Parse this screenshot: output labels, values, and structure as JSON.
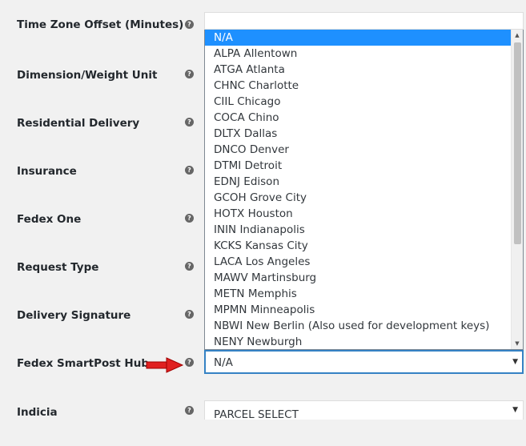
{
  "form": {
    "rows": [
      {
        "label": "Time Zone Offset (Minutes)"
      },
      {
        "label": "Dimension/Weight Unit"
      },
      {
        "label": "Residential Delivery"
      },
      {
        "label": "Insurance"
      },
      {
        "label": "Fedex One"
      },
      {
        "label": "Request Type"
      },
      {
        "label": "Delivery Signature"
      },
      {
        "label": "Fedex SmartPost Hub"
      },
      {
        "label": "Indicia"
      }
    ],
    "help_icon": "question-mark-icon",
    "smartpost_hub": {
      "value": "N/A",
      "options": [
        "N/A",
        "ALPA Allentown",
        "ATGA Atlanta",
        "CHNC Charlotte",
        "CIIL Chicago",
        "COCA Chino",
        "DLTX Dallas",
        "DNCO Denver",
        "DTMI Detroit",
        "EDNJ Edison",
        "GCOH Grove City",
        "HOTX Houston",
        "ININ Indianapolis",
        "KCKS Kansas City",
        "LACA Los Angeles",
        "MAWV Martinsburg",
        "METN Memphis",
        "MPMN Minneapolis",
        "NBWI New Berlin (Also used for development keys)",
        "NENY Newburgh"
      ]
    },
    "indicia": {
      "value": "PARCEL SELECT"
    }
  },
  "colors": {
    "selected_option_bg": "#1e90ff",
    "pointer_arrow": "#e02020"
  }
}
